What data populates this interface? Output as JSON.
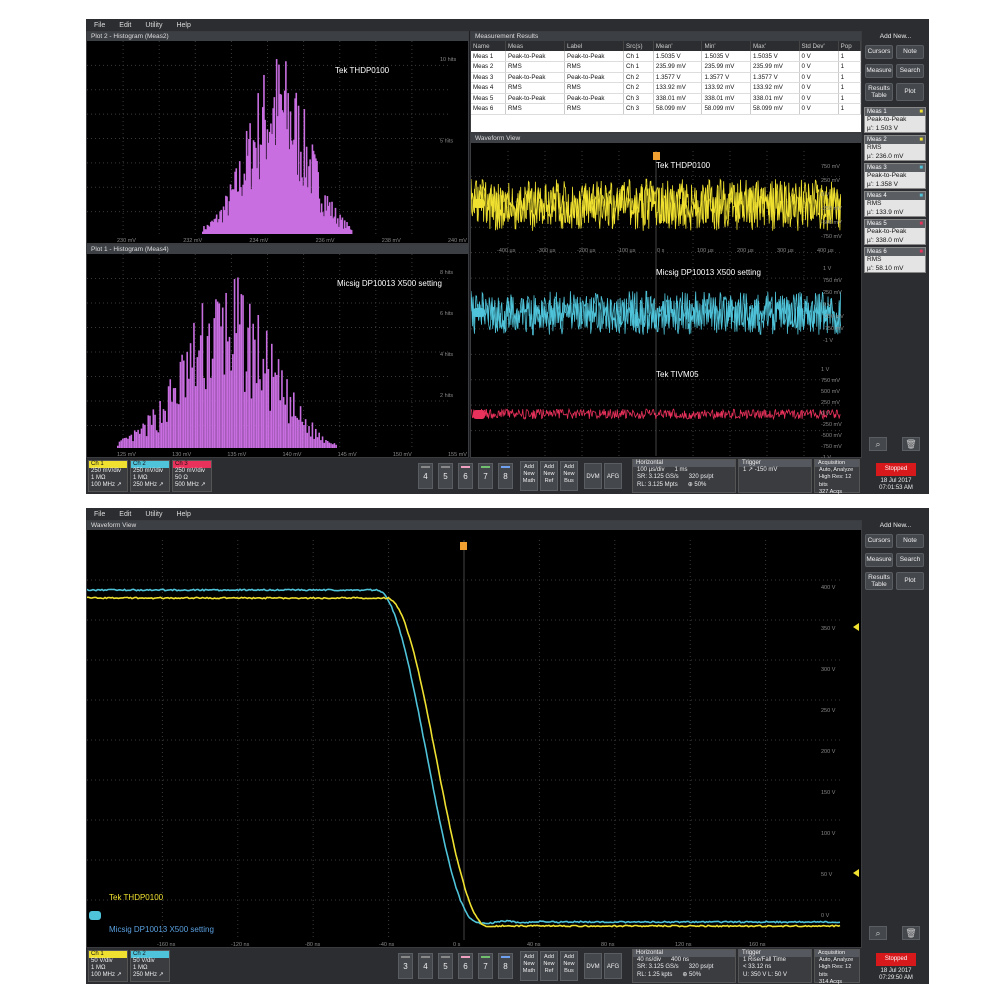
{
  "menu": [
    "File",
    "Edit",
    "Utility",
    "Help"
  ],
  "top": {
    "hist2": {
      "title": "Plot 2 - Histogram (Meas2)",
      "label": "Tek THDP0100",
      "xticks": [
        "230 mV",
        "232 mV",
        "234 mV",
        "236 mV",
        "238 mV",
        "240 mV"
      ],
      "yticks": [
        "10 hits",
        "5 hits"
      ]
    },
    "hist1": {
      "title": "Plot 1 - Histogram (Meas4)",
      "label": "Micsig DP10013 X500 setting",
      "xticks": [
        "125 mV",
        "130 mV",
        "135 mV",
        "140 mV",
        "145 mV",
        "150 mV",
        "155 mV"
      ],
      "yticks": [
        "8 hits",
        "6 hits",
        "4 hits",
        "2 hits"
      ]
    },
    "meas": {
      "title": "Measurement Results",
      "headers": [
        "Name",
        "Meas",
        "Label",
        "Src(s)",
        "Mean'",
        "Min'",
        "Max'",
        "Std Dev'",
        "Pop"
      ],
      "rows": [
        [
          "Meas 1",
          "Peak-to-Peak",
          "Peak-to-Peak",
          "Ch 1",
          "1.5035 V",
          "1.5035 V",
          "1.5035 V",
          "0 V",
          "1"
        ],
        [
          "Meas 2",
          "RMS",
          "RMS",
          "Ch 1",
          "235.99 mV",
          "235.99 mV",
          "235.99 mV",
          "0 V",
          "1"
        ],
        [
          "Meas 3",
          "Peak-to-Peak",
          "Peak-to-Peak",
          "Ch 2",
          "1.3577 V",
          "1.3577 V",
          "1.3577 V",
          "0 V",
          "1"
        ],
        [
          "Meas 4",
          "RMS",
          "RMS",
          "Ch 2",
          "133.92 mV",
          "133.92 mV",
          "133.92 mV",
          "0 V",
          "1"
        ],
        [
          "Meas 5",
          "Peak-to-Peak",
          "Peak-to-Peak",
          "Ch 3",
          "338.01 mV",
          "338.01 mV",
          "338.01 mV",
          "0 V",
          "1"
        ],
        [
          "Meas 6",
          "RMS",
          "RMS",
          "Ch 3",
          "58.099 mV",
          "58.099 mV",
          "58.099 mV",
          "0 V",
          "1"
        ]
      ]
    },
    "wave": {
      "title": "Waveform View",
      "ch1_label": "Tek THDP0100",
      "ch2_label": "Micsig DP10013 X500 setting",
      "ch3_label": "Tek TIVM05",
      "xticks": [
        "-400 µs",
        "-300 µs",
        "-200 µs",
        "-100 µs",
        "0 s",
        "100 µs",
        "200 µs",
        "300 µs",
        "400 µs"
      ],
      "ch1_ticks": [
        "750 mV",
        "250 mV",
        "0 V",
        "-250 mV",
        "-500 mV",
        "-750 mV"
      ],
      "ch2_ticks": [
        "1 V",
        "750 mV",
        "250 mV",
        "0 V",
        "-250 mV",
        "-750 mV",
        "-1 V"
      ],
      "ch3_ticks": [
        "1 V",
        "750 mV",
        "500 mV",
        "250 mV",
        "0 V",
        "-250 mV",
        "-500 mV",
        "-750 mV",
        "-1 V"
      ]
    },
    "side": {
      "add_new": "Add New...",
      "cursors": "Cursors",
      "note": "Note",
      "measure": "Measure",
      "search": "Search",
      "results_table": "Results Table",
      "plot": "Plot",
      "badges": [
        {
          "name": "Meas 1",
          "type": "Peak-to-Peak",
          "val": "µ': 1.503 V",
          "color": "#f0e130"
        },
        {
          "name": "Meas 2",
          "type": "RMS",
          "val": "µ': 236.0 mV",
          "color": "#f0e130"
        },
        {
          "name": "Meas 3",
          "type": "Peak-to-Peak",
          "val": "µ': 1.358 V",
          "color": "#4fc3d9"
        },
        {
          "name": "Meas 4",
          "type": "RMS",
          "val": "µ': 133.9 mV",
          "color": "#4fc3d9"
        },
        {
          "name": "Meas 5",
          "type": "Peak-to-Peak",
          "val": "µ': 338.0 mV",
          "color": "#e8315b"
        },
        {
          "name": "Meas 6",
          "type": "RMS",
          "val": "µ': 58.10 mV",
          "color": "#e8315b"
        }
      ]
    },
    "bottom": {
      "ch": [
        {
          "name": "Ch 1",
          "l1": "250 mV/div",
          "l2": "1 MΩ",
          "l3": "100 MHz ↗",
          "color": "#f0e130"
        },
        {
          "name": "Ch 2",
          "l1": "250 mV/div",
          "l2": "1 MΩ",
          "l3": "250 MHz ↗",
          "color": "#4fc3d9"
        },
        {
          "name": "Ch 3",
          "l1": "250 mV/div",
          "l2": "50 Ω",
          "l3": "500 MHz ↗",
          "color": "#e8315b"
        }
      ],
      "nums": [
        "4",
        "5",
        "6",
        "7",
        "8"
      ],
      "add": [
        [
          "Add",
          "New",
          "Math"
        ],
        [
          "Add",
          "New",
          "Ref"
        ],
        [
          "Add",
          "New",
          "Bus"
        ]
      ],
      "dvm": "DVM",
      "afg": "AFG",
      "horizontal": {
        "title": "Horizontal",
        "r1a": "100 µs/div",
        "r1b": "1 ms",
        "r2a": "SR: 3.125 GS/s",
        "r2b": "320 ps/pt",
        "r3a": "RL: 3.125 Mpts",
        "r3b": "⊕ 50%"
      },
      "trigger": {
        "title": "Trigger",
        "r1": "1  ↗  -150 mV"
      },
      "acq": {
        "title": "Acquisition",
        "r1": "Auto,    Analyze",
        "r2": "High Res: 12 bits",
        "r3": "327 Acqs"
      },
      "stopped": "Stopped",
      "date": "18 Jul 2017",
      "time": "07:01:53 AM"
    }
  },
  "bottomscope": {
    "wave": {
      "title": "Waveform View",
      "ch1_label": "Tek THDP0100",
      "ch2_label": "Micsig DP10013 X500 setting",
      "xticks": [
        "-160 ns",
        "-120 ns",
        "-80 ns",
        "-40 ns",
        "0 s",
        "40 ns",
        "80 ns",
        "120 ns",
        "160 ns"
      ],
      "yticks": [
        "400 V",
        "350 V",
        "300 V",
        "250 V",
        "200 V",
        "150 V",
        "100 V",
        "50 V",
        "0 V"
      ]
    },
    "side": {
      "add_new": "Add New...",
      "cursors": "Cursors",
      "note": "Note",
      "measure": "Measure",
      "search": "Search",
      "results_table": "Results Table",
      "plot": "Plot"
    },
    "bottom": {
      "ch": [
        {
          "name": "Ch 1",
          "l1": "50 V/div",
          "l2": "1 MΩ",
          "l3": "100 MHz ↗",
          "color": "#f0e130"
        },
        {
          "name": "Ch 2",
          "l1": "50 V/div",
          "l2": "1 MΩ",
          "l3": "250 MHz ↗",
          "color": "#4fc3d9"
        }
      ],
      "nums": [
        "3",
        "4",
        "5",
        "6",
        "7",
        "8"
      ],
      "add": [
        [
          "Add",
          "New",
          "Math"
        ],
        [
          "Add",
          "New",
          "Ref"
        ],
        [
          "Add",
          "New",
          "Bus"
        ]
      ],
      "dvm": "DVM",
      "afg": "AFG",
      "horizontal": {
        "title": "Horizontal",
        "r1a": "40 ns/div",
        "r1b": "400 ns",
        "r2a": "SR: 3.125 GS/s",
        "r2b": "320 ps/pt",
        "r3a": "RL: 1.25 kpts",
        "r3b": "⊕ 50%"
      },
      "trigger": {
        "title": "Trigger",
        "r1": "1  Rise/Fall Time",
        "r2": "< 33.12 ns",
        "r3": "U: 350 V  L: 50 V"
      },
      "acq": {
        "title": "Acquisition",
        "r1": "Auto,    Analyze",
        "r2": "High Res: 12 bits",
        "r3": "314 Acqs"
      },
      "stopped": "Stopped",
      "date": "18 Jul 2017",
      "time": "07:29:50 AM"
    }
  },
  "colors": {
    "ch1": "#f0e130",
    "ch2": "#4fc3d9",
    "ch3": "#e8315b",
    "hist": "#c86ee0",
    "trig": "#f0a030"
  }
}
